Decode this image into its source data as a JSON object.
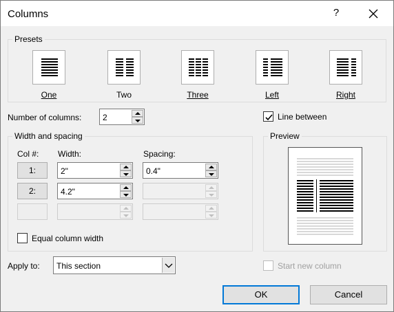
{
  "window": {
    "title": "Columns",
    "help": "?"
  },
  "presets": {
    "label": "Presets",
    "items": [
      {
        "label": "One"
      },
      {
        "label": "Two"
      },
      {
        "label": "Three"
      },
      {
        "label": "Left"
      },
      {
        "label": "Right"
      }
    ]
  },
  "num_columns": {
    "label": "Number of columns:",
    "value": "2"
  },
  "line_between": {
    "label": "Line between",
    "checked": true
  },
  "width_spacing": {
    "label": "Width and spacing",
    "col_header": "Col #:",
    "width_header": "Width:",
    "spacing_header": "Spacing:",
    "rows": [
      {
        "col": "1:",
        "width": "2\"",
        "spacing": "0.4\""
      },
      {
        "col": "2:",
        "width": "4.2\"",
        "spacing": ""
      },
      {
        "col": "",
        "width": "",
        "spacing": ""
      }
    ]
  },
  "equal_width": {
    "label": "Equal column width",
    "checked": false
  },
  "preview": {
    "label": "Preview"
  },
  "apply_to": {
    "label": "Apply to:",
    "value": "This section"
  },
  "start_new_column": {
    "label": "Start new column",
    "checked": false,
    "enabled": false
  },
  "buttons": {
    "ok": "OK",
    "cancel": "Cancel"
  }
}
